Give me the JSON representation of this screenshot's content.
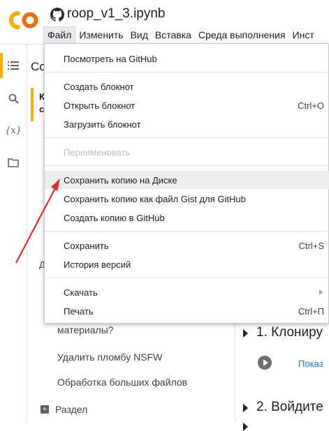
{
  "header": {
    "title": "roop_v1_3.ipynb",
    "logo_text": "CO",
    "menus": [
      "Файл",
      "Изменить",
      "Вид",
      "Вставка",
      "Среда выполнения",
      "Инст"
    ]
  },
  "rail": {
    "icons": [
      "toc-icon",
      "search-icon",
      "variables-icon",
      "folder-icon"
    ],
    "variables_glyph": "{x}"
  },
  "toc": {
    "title_fragment": "Co",
    "bold_frag_1": "К",
    "bold_frag_2": "с",
    "frag_3": "Д",
    "items": [
      "материалы?",
      "Удалить пломбу NSFW",
      "Обработка больших файлов"
    ],
    "add_section": "Раздел"
  },
  "notebook": {
    "heading_1": "1. Клониру",
    "show_link": "Показ",
    "heading_2": "2. Войдите"
  },
  "file_menu": {
    "groups": [
      [
        {
          "label": "Посмотреть на GitHub",
          "shortcut": ""
        }
      ],
      [
        {
          "label": "Создать блокнот",
          "shortcut": ""
        },
        {
          "label": "Открыть блокнот",
          "shortcut": "Ctrl+O"
        },
        {
          "label": "Загрузить блокнот",
          "shortcut": ""
        }
      ],
      [
        {
          "label": "Переименовать",
          "shortcut": "",
          "disabled": true
        }
      ],
      [
        {
          "label": "Сохранить копию на Диске",
          "shortcut": "",
          "highlighted": true
        },
        {
          "label": "Сохранить копию как файл Gist для GitHub",
          "shortcut": ""
        },
        {
          "label": "Создать копию в GitHub",
          "shortcut": ""
        }
      ],
      [
        {
          "label": "Сохранить",
          "shortcut": "Ctrl+S"
        },
        {
          "label": "История версий",
          "shortcut": ""
        }
      ],
      [
        {
          "label": "Скачать",
          "shortcut": "",
          "submenu": true
        },
        {
          "label": "Печать",
          "shortcut": "Ctrl+П"
        }
      ]
    ]
  },
  "colors": {
    "colab_orange": "#f9ab00",
    "link_blue": "#1a73e8",
    "annotation_red": "#e8262b",
    "menu_highlight": "#eeeeee"
  }
}
